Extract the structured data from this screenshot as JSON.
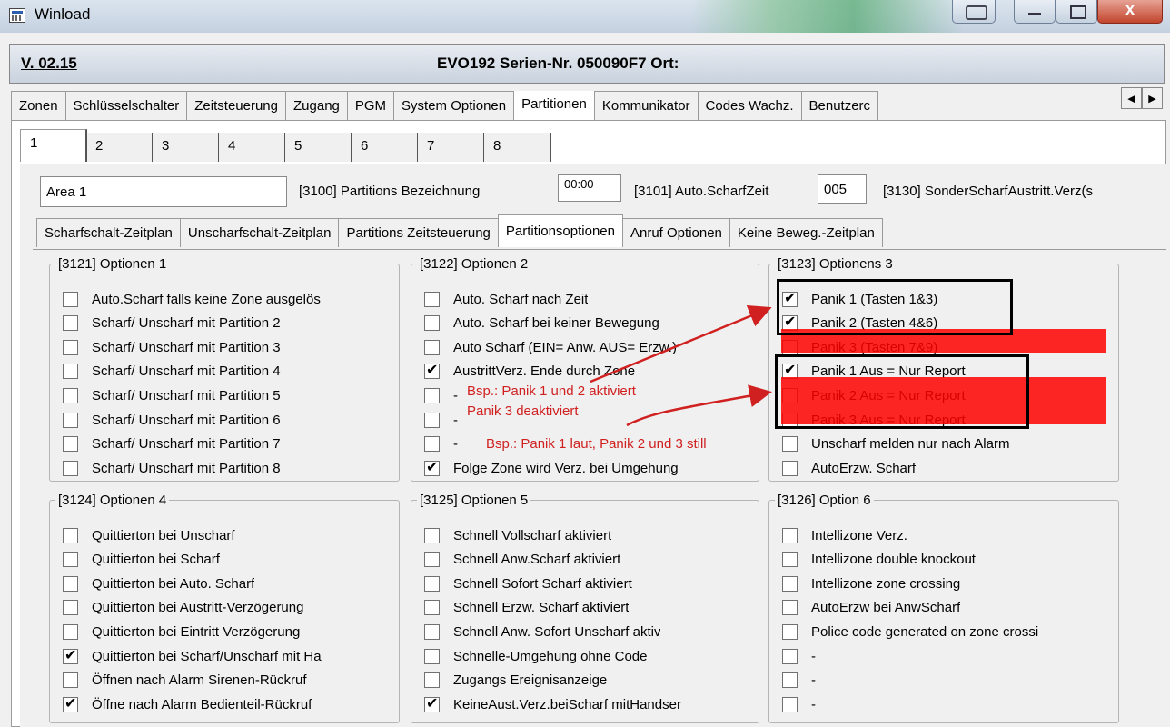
{
  "window": {
    "title": "Winload"
  },
  "header": {
    "version": "V. 02.15",
    "device_info": "EVO192  Serien-Nr. 050090F7 Ort:"
  },
  "main_tabs": [
    "Zonen",
    "Schlüsselschalter",
    "Zeitsteuerung",
    "Zugang",
    "PGM",
    "System Optionen",
    "Partitionen",
    "Kommunikator",
    "Codes Wachz.",
    "Benutzerc"
  ],
  "main_tabs_active": "Partitionen",
  "partition_tabs": [
    "1",
    "2",
    "3",
    "4",
    "5",
    "6",
    "7",
    "8"
  ],
  "partition_tabs_active": "1",
  "partition_fields": {
    "name_value": "Area 1",
    "name_label": "[3100] Partitions Bezeichnung",
    "time_value": "00:00",
    "time_label": "[3101] Auto.ScharfZeit",
    "exit_delay_value": "005",
    "exit_delay_label": "[3130] SonderScharfAustritt.Verz(s"
  },
  "sub_tabs": [
    "Scharfschalt-Zeitplan",
    "Unscharfschalt-Zeitplan",
    "Partitions Zeitsteuerung",
    "Partitionsoptionen",
    "Anruf Optionen",
    "Keine Beweg.-Zeitplan"
  ],
  "sub_tabs_active": "Partitionsoptionen",
  "groups": [
    {
      "title": "[3121]  Optionen 1",
      "options": [
        {
          "label": "Auto.Scharf falls keine Zone ausgelös",
          "checked": false
        },
        {
          "label": "Scharf/ Unscharf mit Partition 2",
          "checked": false
        },
        {
          "label": "Scharf/ Unscharf mit Partition 3",
          "checked": false
        },
        {
          "label": "Scharf/ Unscharf mit Partition 4",
          "checked": false
        },
        {
          "label": "Scharf/ Unscharf mit Partition 5",
          "checked": false
        },
        {
          "label": "Scharf/ Unscharf mit Partition 6",
          "checked": false
        },
        {
          "label": "Scharf/ Unscharf mit Partition 7",
          "checked": false
        },
        {
          "label": "Scharf/ Unscharf mit Partition 8",
          "checked": false
        }
      ]
    },
    {
      "title": "[3122]  Optionen 2",
      "options": [
        {
          "label": "Auto. Scharf nach Zeit",
          "checked": false
        },
        {
          "label": "Auto. Scharf bei keiner Bewegung",
          "checked": false
        },
        {
          "label": "Auto Scharf (EIN= Anw. AUS= Erzw.)",
          "checked": false
        },
        {
          "label": "AustrittVerz. Ende durch Zone",
          "checked": true
        },
        {
          "label": "-",
          "checked": false
        },
        {
          "label": "-",
          "checked": false
        },
        {
          "label": "-",
          "checked": false
        },
        {
          "label": "Folge Zone wird Verz. bei Umgehung",
          "checked": true
        }
      ]
    },
    {
      "title": "[3123]  Optionens 3",
      "options": [
        {
          "label": "Panik 1 (Tasten 1&3)",
          "checked": true
        },
        {
          "label": "Panik 2 (Tasten 4&6)",
          "checked": true
        },
        {
          "label": "Panik 3 (Tasten 7&9)",
          "checked": false
        },
        {
          "label": "Panik 1 Aus = Nur Report",
          "checked": true
        },
        {
          "label": "Panik 2 Aus = Nur Report",
          "checked": false
        },
        {
          "label": "Panik 3 Aus = Nur Report",
          "checked": false
        },
        {
          "label": "Unscharf melden nur nach Alarm",
          "checked": false
        },
        {
          "label": "AutoErzw. Scharf",
          "checked": false
        }
      ]
    },
    {
      "title": "[3124]  Optionen 4",
      "options": [
        {
          "label": "Quittierton bei Unscharf",
          "checked": false
        },
        {
          "label": "Quittierton bei Scharf",
          "checked": false
        },
        {
          "label": "Quittierton bei Auto. Scharf",
          "checked": false
        },
        {
          "label": "Quittierton bei Austritt-Verzögerung",
          "checked": false
        },
        {
          "label": "Quittierton bei Eintritt Verzögerung",
          "checked": false
        },
        {
          "label": "Quittierton bei Scharf/Unscharf mit Ha",
          "checked": true
        },
        {
          "label": "Öffnen nach Alarm Sirenen-Rückruf",
          "checked": false
        },
        {
          "label": "Öffne nach Alarm Bedienteil-Rückruf",
          "checked": true
        }
      ]
    },
    {
      "title": "[3125]  Optionen 5",
      "options": [
        {
          "label": "Schnell Vollscharf aktiviert",
          "checked": false
        },
        {
          "label": "Schnell Anw.Scharf aktiviert",
          "checked": false
        },
        {
          "label": "Schnell Sofort Scharf aktiviert",
          "checked": false
        },
        {
          "label": "Schnell Erzw. Scharf aktiviert",
          "checked": false
        },
        {
          "label": "Schnell Anw. Sofort Unscharf aktiv",
          "checked": false
        },
        {
          "label": "Schnelle-Umgehung ohne Code",
          "checked": false
        },
        {
          "label": "Zugangs Ereignisanzeige",
          "checked": false
        },
        {
          "label": "KeineAust.Verz.beiScharf mitHandser",
          "checked": true
        }
      ]
    },
    {
      "title": "[3126]  Option 6",
      "options": [
        {
          "label": "Intellizone Verz.",
          "checked": false
        },
        {
          "label": "Intellizone double knockout",
          "checked": false
        },
        {
          "label": "Intellizone zone crossing",
          "checked": false
        },
        {
          "label": "AutoErzw bei AnwScharf",
          "checked": false
        },
        {
          "label": "Police code generated on zone crossi",
          "checked": false
        },
        {
          "label": "-",
          "checked": false
        },
        {
          "label": "-",
          "checked": false
        },
        {
          "label": "-",
          "checked": false
        }
      ]
    }
  ],
  "annotations": [
    "Bsp.: Panik 1 und 2 aktiviert",
    "Panik 3 deaktiviert",
    "Bsp.: Panik 1 laut, Panik 2 und 3 still"
  ],
  "colors": {
    "highlight": "#ff0000",
    "annotation": "#d02020"
  }
}
